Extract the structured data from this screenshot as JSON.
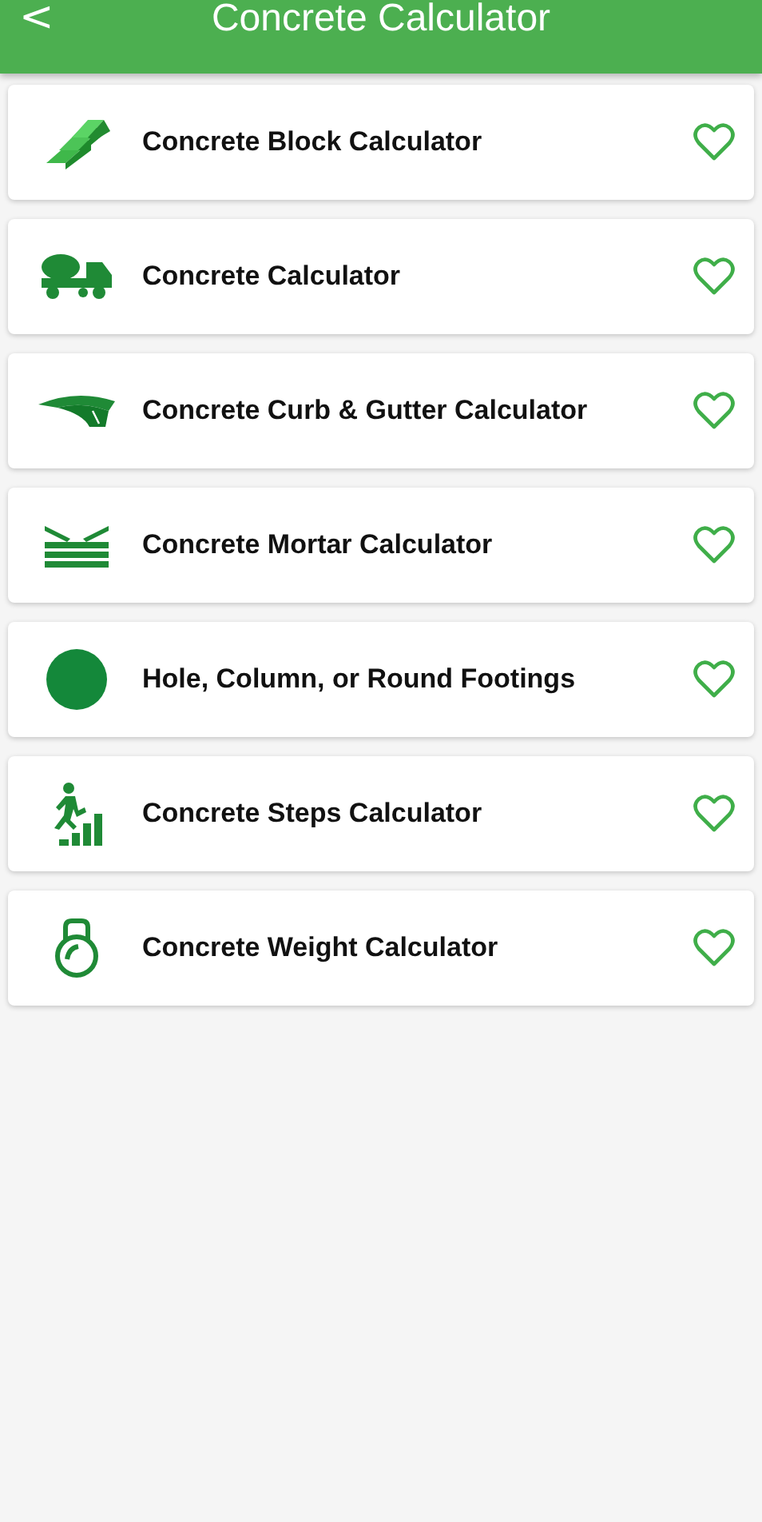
{
  "header": {
    "back": "<",
    "title": "Concrete Calculator"
  },
  "items": [
    {
      "kind": "blocks",
      "label": "Concrete Block Calculator",
      "favorite": false
    },
    {
      "kind": "truck",
      "label": "Concrete Calculator",
      "favorite": false
    },
    {
      "kind": "curb",
      "label": "Concrete Curb & Gutter Calculator",
      "favorite": false
    },
    {
      "kind": "mortar",
      "label": "Concrete Mortar Calculator",
      "favorite": false
    },
    {
      "kind": "circle",
      "label": "Hole, Column, or Round Footings",
      "favorite": false
    },
    {
      "kind": "steps",
      "label": "Concrete Steps Calculator",
      "favorite": false
    },
    {
      "kind": "weight",
      "label": "Concrete Weight Calculator",
      "favorite": false
    }
  ]
}
